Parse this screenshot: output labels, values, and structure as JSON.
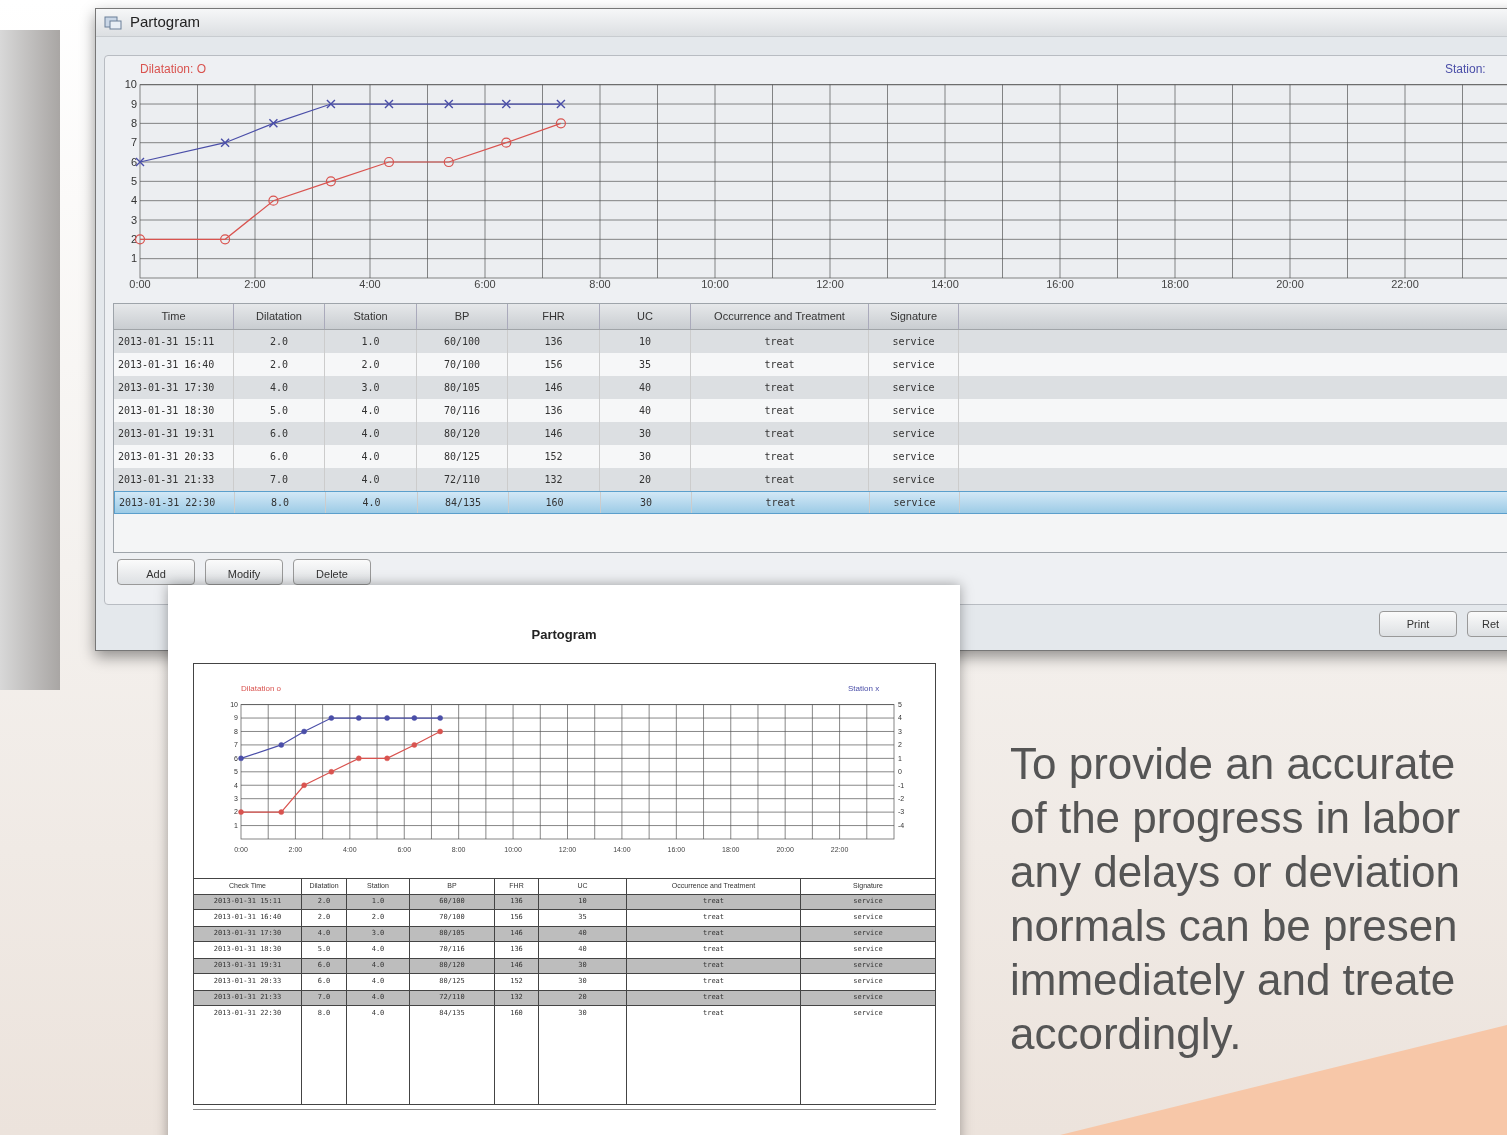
{
  "window": {
    "title": "Partogram"
  },
  "chart": {
    "chart_data": {
      "type": "line",
      "grid": true,
      "x": [
        0,
        1.48,
        2.32,
        3.32,
        4.33,
        5.37,
        6.37,
        7.32
      ],
      "series": [
        {
          "name": "Dilatation: O",
          "color": "#d9534f",
          "marker": "circle",
          "values": [
            2,
            2,
            4,
            5,
            6,
            6,
            7,
            8
          ]
        },
        {
          "name": "Station:",
          "color": "#4a4ea8",
          "marker": "cross",
          "values": [
            6,
            7,
            8,
            9,
            9,
            9,
            9,
            9
          ]
        }
      ],
      "xlim": [
        0,
        24
      ],
      "ylim": [
        0,
        10
      ],
      "xticks": [
        {
          "value": 0,
          "label": "0:00"
        },
        {
          "value": 2,
          "label": "2:00"
        },
        {
          "value": 4,
          "label": "4:00"
        },
        {
          "value": 6,
          "label": "6:00"
        },
        {
          "value": 8,
          "label": "8:00"
        },
        {
          "value": 10,
          "label": "10:00"
        },
        {
          "value": 12,
          "label": "12:00"
        },
        {
          "value": 14,
          "label": "14:00"
        },
        {
          "value": 16,
          "label": "16:00"
        },
        {
          "value": 18,
          "label": "18:00"
        },
        {
          "value": 20,
          "label": "20:00"
        },
        {
          "value": 22,
          "label": "22:00"
        }
      ],
      "yticks": [
        1,
        2,
        3,
        4,
        5,
        6,
        7,
        8,
        9,
        10
      ]
    }
  },
  "table": {
    "columns": [
      "Time",
      "Dilatation",
      "Station",
      "BP",
      "FHR",
      "UC",
      "Occurrence and Treatment",
      "Signature"
    ],
    "rows": [
      {
        "selected": false,
        "cells": [
          "2013-01-31 15:11",
          "2.0",
          "1.0",
          "60/100",
          "136",
          "10",
          "treat",
          "service"
        ]
      },
      {
        "selected": false,
        "cells": [
          "2013-01-31 16:40",
          "2.0",
          "2.0",
          "70/100",
          "156",
          "35",
          "treat",
          "service"
        ]
      },
      {
        "selected": false,
        "cells": [
          "2013-01-31 17:30",
          "4.0",
          "3.0",
          "80/105",
          "146",
          "40",
          "treat",
          "service"
        ]
      },
      {
        "selected": false,
        "cells": [
          "2013-01-31 18:30",
          "5.0",
          "4.0",
          "70/116",
          "136",
          "40",
          "treat",
          "service"
        ]
      },
      {
        "selected": false,
        "cells": [
          "2013-01-31 19:31",
          "6.0",
          "4.0",
          "80/120",
          "146",
          "30",
          "treat",
          "service"
        ]
      },
      {
        "selected": false,
        "cells": [
          "2013-01-31 20:33",
          "6.0",
          "4.0",
          "80/125",
          "152",
          "30",
          "treat",
          "service"
        ]
      },
      {
        "selected": false,
        "cells": [
          "2013-01-31 21:33",
          "7.0",
          "4.0",
          "72/110",
          "132",
          "20",
          "treat",
          "service"
        ]
      },
      {
        "selected": true,
        "cells": [
          "2013-01-31 22:30",
          "8.0",
          "4.0",
          "84/135",
          "160",
          "30",
          "treat",
          "service"
        ]
      }
    ]
  },
  "buttons": [
    "Add",
    "Modify",
    "Delete"
  ],
  "footer_buttons": [
    "Print",
    "Ret"
  ],
  "print_preview": {
    "title": "Partogram",
    "chart": {
      "secondary_ticks": [
        "5",
        "4",
        "3",
        "2",
        "1",
        "0",
        "-1",
        "-2",
        "-3",
        "-4"
      ],
      "chart_data": {
        "type": "line",
        "grid": true,
        "x": [
          0,
          1.48,
          2.32,
          3.32,
          4.33,
          5.37,
          6.37,
          7.32
        ],
        "series": [
          {
            "name": "Dilatation o",
            "color": "#d9534f",
            "marker": "circle",
            "values": [
              2,
              2,
              4,
              5,
              6,
              6,
              7,
              8
            ]
          },
          {
            "name": "Station x",
            "color": "#4a4ea8",
            "marker": "circle",
            "values": [
              6,
              7,
              8,
              9,
              9,
              9,
              9,
              9
            ]
          }
        ],
        "xlim": [
          0,
          24
        ],
        "ylim": [
          0,
          10
        ],
        "xticks": [
          {
            "value": 0,
            "label": "0:00"
          },
          {
            "value": 2,
            "label": "2:00"
          },
          {
            "value": 4,
            "label": "4:00"
          },
          {
            "value": 6,
            "label": "6:00"
          },
          {
            "value": 8,
            "label": "8:00"
          },
          {
            "value": 10,
            "label": "10:00"
          },
          {
            "value": 12,
            "label": "12:00"
          },
          {
            "value": 14,
            "label": "14:00"
          },
          {
            "value": 16,
            "label": "16:00"
          },
          {
            "value": 18,
            "label": "18:00"
          },
          {
            "value": 20,
            "label": "20:00"
          },
          {
            "value": 22,
            "label": "22:00"
          }
        ],
        "yticks": [
          1,
          2,
          3,
          4,
          5,
          6,
          7,
          8,
          9,
          10
        ]
      }
    },
    "table": {
      "columns": [
        "Check Time",
        "Dilatation",
        "Station",
        "BP",
        "FHR",
        "UC",
        "Occurrence and Treatment",
        "Signature"
      ],
      "rows": [
        [
          "2013-01-31 15:11",
          "2.0",
          "1.0",
          "60/100",
          "136",
          "10",
          "treat",
          "service"
        ],
        [
          "2013-01-31 16:40",
          "2.0",
          "2.0",
          "70/100",
          "156",
          "35",
          "treat",
          "service"
        ],
        [
          "2013-01-31 17:30",
          "4.0",
          "3.0",
          "80/105",
          "146",
          "40",
          "treat",
          "service"
        ],
        [
          "2013-01-31 18:30",
          "5.0",
          "4.0",
          "70/116",
          "136",
          "40",
          "treat",
          "service"
        ],
        [
          "2013-01-31 19:31",
          "6.0",
          "4.0",
          "80/120",
          "146",
          "30",
          "treat",
          "service"
        ],
        [
          "2013-01-31 20:33",
          "6.0",
          "4.0",
          "80/125",
          "152",
          "30",
          "treat",
          "service"
        ],
        [
          "2013-01-31 21:33",
          "7.0",
          "4.0",
          "72/110",
          "132",
          "20",
          "treat",
          "service"
        ],
        [
          "2013-01-31 22:30",
          "8.0",
          "4.0",
          "84/135",
          "160",
          "30",
          "treat",
          "service"
        ]
      ]
    }
  },
  "tagline": [
    "To provide an accurate",
    "of the progress in labor",
    "any delays or deviation",
    "normals can be presen",
    "immediately and treate",
    "accordingly."
  ]
}
